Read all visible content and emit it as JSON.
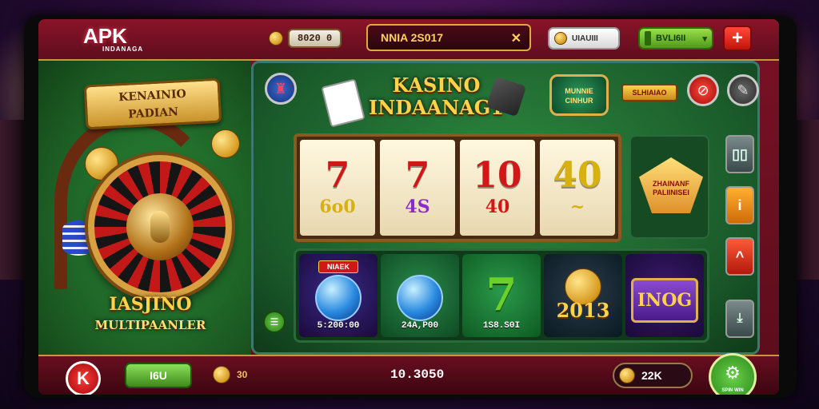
{
  "app": {
    "logo": "APK",
    "logo_sub": "INDANAGA"
  },
  "topbar": {
    "balance": "8020 0",
    "player_name": "NNIA 2S017",
    "name_close_icon": "close-icon",
    "white_button": "UIAUIII",
    "green_button": "BVLI6II",
    "plus_label": "+"
  },
  "left_panel": {
    "banner_line1": "KENAINIO",
    "banner_line2": "PADIAN",
    "label_line1": "IASJINO",
    "label_line2": "MULTIPAANLER"
  },
  "main": {
    "title_line1": "KASINO",
    "title_line2": "INDAANAG1",
    "badge_text": "MUNNIE CINHUR",
    "sign_text": "SLHIAIAO",
    "reels": [
      {
        "top": "7",
        "bottom": "6o0",
        "top_color": "red",
        "bottom_color": "yellow"
      },
      {
        "top": "7",
        "bottom": "4S",
        "top_color": "red",
        "bottom_color": "purple"
      },
      {
        "top": "10",
        "bottom": "40",
        "top_color": "red",
        "bottom_color": "red"
      },
      {
        "top": "40",
        "bottom": "~",
        "top_color": "yellow",
        "bottom_color": "yellow"
      }
    ],
    "bonus_text": "ZHAINANF PALIINISEI",
    "side_buttons": [
      "▯▯",
      "i",
      "^"
    ],
    "games": [
      {
        "tag": "NIAEK",
        "value": "5:200:00",
        "type": "orb"
      },
      {
        "tag": "",
        "value": "24A,P00",
        "type": "orb"
      },
      {
        "tag": "",
        "value": "1S8.S0I",
        "type": "seven"
      },
      {
        "tag": "",
        "value": "2013",
        "type": "trophy"
      },
      {
        "tag": "",
        "value": "",
        "type": "emblem",
        "emblem_text": "INOG"
      }
    ]
  },
  "bottombar": {
    "k_button": "K",
    "green_button": "I6U",
    "bet_value": "30",
    "win_value": "10.3050",
    "total_value": "22K",
    "spin_label": "SPIN WIN"
  },
  "colors": {
    "accent_gold": "#e0a840",
    "felt_green": "#1a5a2a",
    "frame_red": "#7a1224"
  }
}
